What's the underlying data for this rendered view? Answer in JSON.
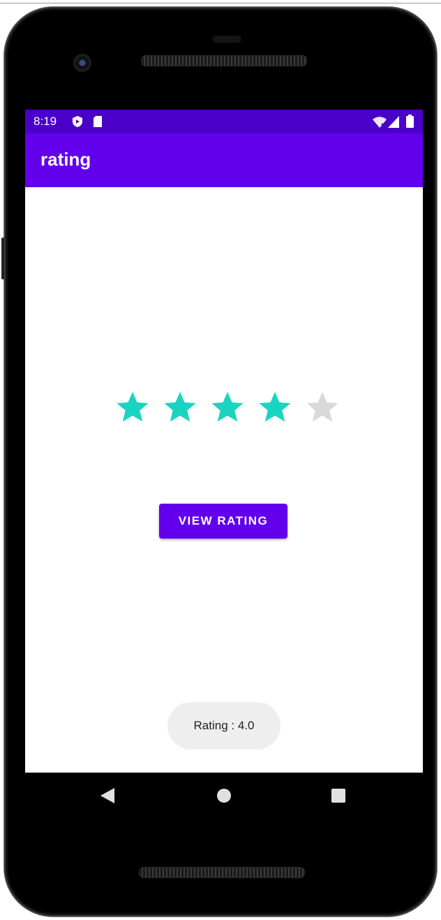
{
  "status_bar": {
    "time": "8:19",
    "icons": [
      "shield-icon",
      "sd-card-icon",
      "wifi-icon",
      "signal-icon",
      "battery-icon"
    ]
  },
  "app_bar": {
    "title": "rating"
  },
  "rating": {
    "value": 4,
    "max": 5,
    "filled_color": "#1ad4c2",
    "empty_color": "#d9d9d9"
  },
  "button": {
    "label": "VIEW RATING"
  },
  "toast": {
    "text": "Rating : 4.0"
  },
  "nav_bar": {
    "icons": [
      "back-icon",
      "home-icon",
      "recents-icon"
    ]
  },
  "colors": {
    "status_bar": "#4a00c8",
    "primary": "#6200ee"
  }
}
